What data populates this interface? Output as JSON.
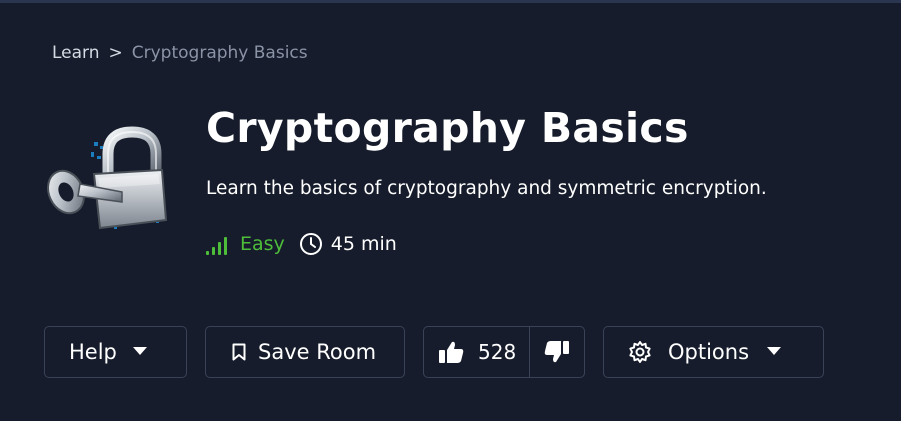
{
  "breadcrumb": {
    "root": "Learn",
    "separator": ">",
    "current": "Cryptography Basics"
  },
  "room": {
    "title": "Cryptography Basics",
    "description": "Learn the basics of cryptography and symmetric encryption.",
    "difficulty": "Easy",
    "duration": "45 min",
    "icon": "padlock-key-icon"
  },
  "actions": {
    "help_label": "Help",
    "save_label": "Save Room",
    "likes": "528",
    "options_label": "Options"
  },
  "colors": {
    "background": "#161c2b",
    "difficulty": "#4dbd3a",
    "border": "#3a4356",
    "muted_text": "#8b93a6"
  }
}
